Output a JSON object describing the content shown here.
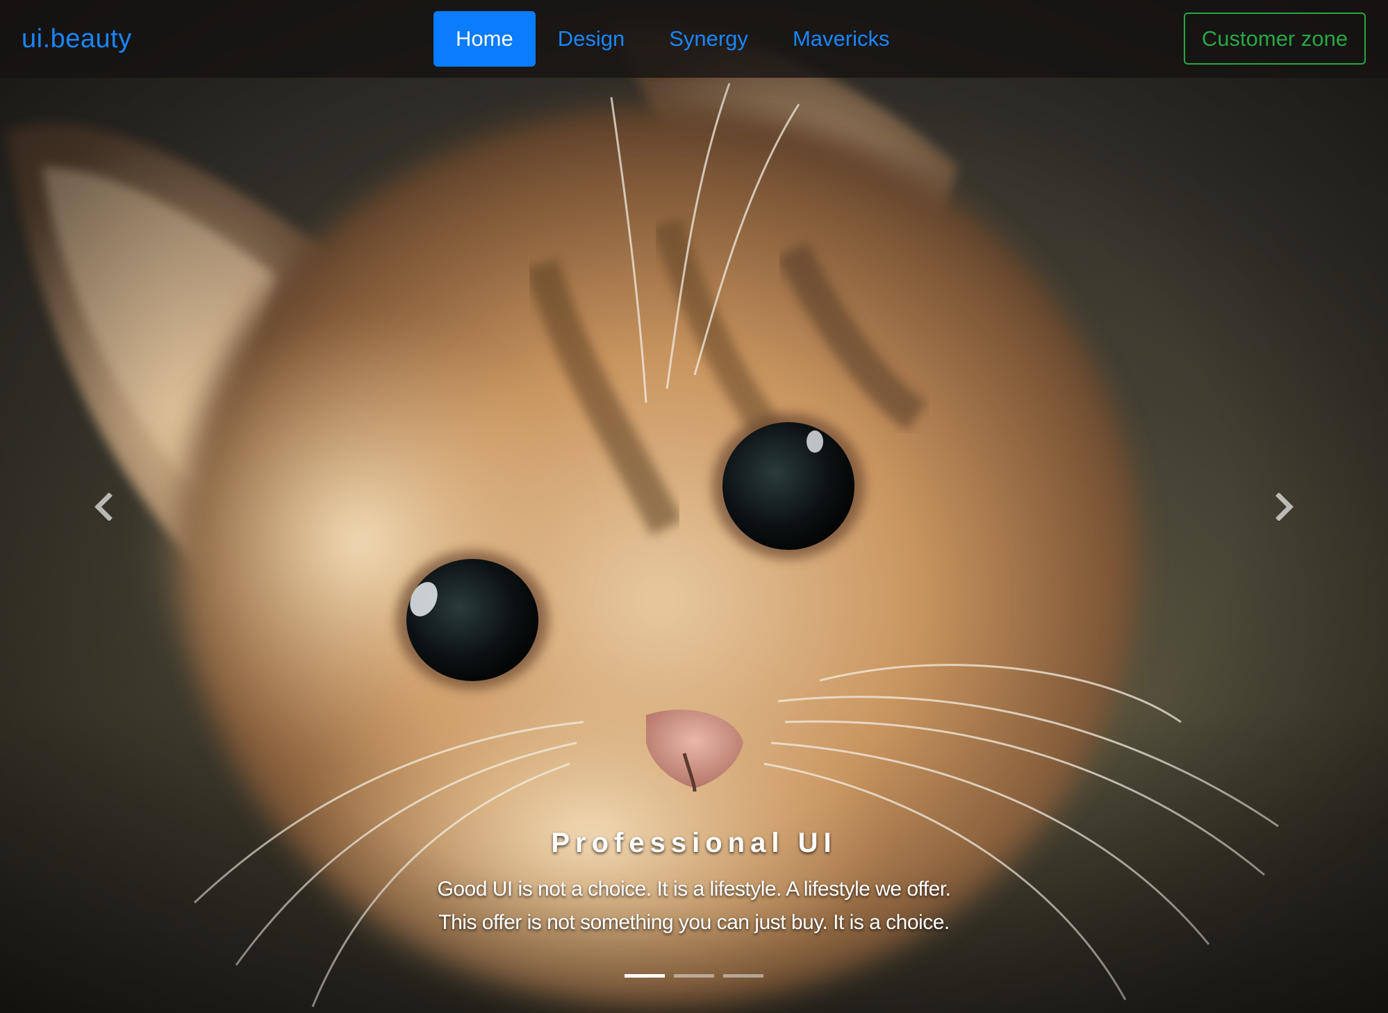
{
  "brand": {
    "label": "ui.beauty",
    "color": "#1a86ff"
  },
  "nav": {
    "items": [
      {
        "label": "Home",
        "active": true
      },
      {
        "label": "Design",
        "active": false
      },
      {
        "label": "Synergy",
        "active": false
      },
      {
        "label": "Mavericks",
        "active": false
      }
    ],
    "accent_color": "#0a7cff"
  },
  "customer_zone": {
    "label": "Customer zone",
    "color": "#28a745"
  },
  "carousel": {
    "slide_image": "kitten-photo",
    "prev_icon": "chevron-left-icon",
    "next_icon": "chevron-right-icon",
    "caption": {
      "title": "Professional UI",
      "line1": "Good UI is not a choice. It is a lifestyle. A lifestyle we offer.",
      "line2": "This offer is not something you can just buy. It is a choice."
    },
    "slide_count": 3,
    "active_index": 0
  }
}
